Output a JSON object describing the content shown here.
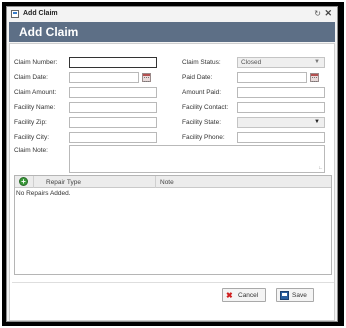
{
  "window": {
    "title": "Add Claim",
    "header_title": "Add Claim"
  },
  "form": {
    "left": [
      {
        "label": "Claim Number:",
        "value": ""
      },
      {
        "label": "Claim Date:",
        "value": ""
      },
      {
        "label": "Claim Amount:",
        "value": ""
      },
      {
        "label": "Facility Name:",
        "value": ""
      },
      {
        "label": "Facility Zip:",
        "value": ""
      },
      {
        "label": "Facility City:",
        "value": ""
      }
    ],
    "right": [
      {
        "label": "Claim Status:",
        "value": "Closed"
      },
      {
        "label": "Paid Date:",
        "value": ""
      },
      {
        "label": "Amount Paid:",
        "value": ""
      },
      {
        "label": "Facility Contact:",
        "value": ""
      },
      {
        "label": "Facility State:",
        "value": ""
      },
      {
        "label": "Facility Phone:",
        "value": ""
      }
    ],
    "note_label": "Claim Note:",
    "note_value": ""
  },
  "repairs": {
    "columns": [
      "Repair Type",
      "Note"
    ],
    "empty_text": "No Repairs Added."
  },
  "buttons": {
    "cancel": "Cancel",
    "save": "Save"
  },
  "icons": {
    "window": "window-icon",
    "pin": "pin-icon",
    "close": "close-icon",
    "calendar": "calendar-icon",
    "add": "add-circle-icon",
    "cancel": "x-icon",
    "save": "floppy-disk-icon"
  },
  "colors": {
    "header": "#5d6f86",
    "add_icon": "#3a9a3a",
    "cancel_icon": "#d02020",
    "save_icon": "#2a5fa0"
  }
}
